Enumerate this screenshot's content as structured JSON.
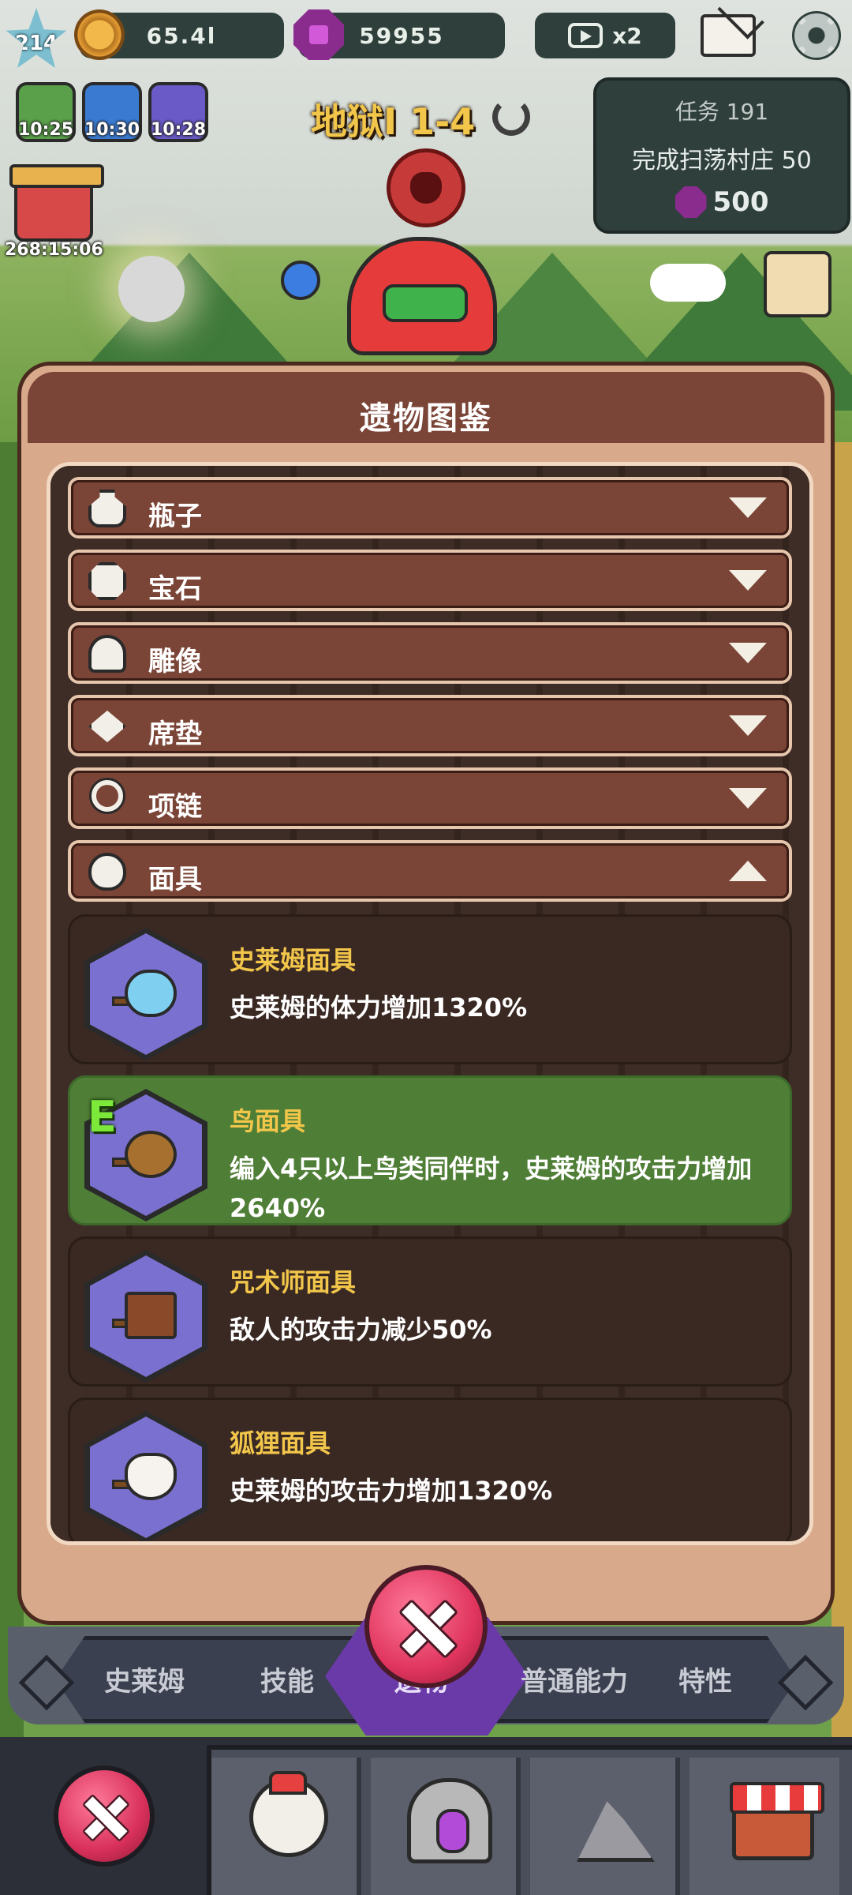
{
  "hud": {
    "level": "214",
    "gold": "65.4l",
    "gems": "59955",
    "ad_multiplier": "x2"
  },
  "boosts": {
    "timers": [
      "10:25",
      "10:30",
      "10:28"
    ],
    "chest_timer": "268:15:06"
  },
  "stage": {
    "title": "地狱I 1-4"
  },
  "quest": {
    "title": "任务 191",
    "description": "完成扫荡村庄 50",
    "reward": "500"
  },
  "modal": {
    "title": "遗物图鉴",
    "categories": [
      {
        "label": "瓶子",
        "icon": "bottle-icon",
        "expanded": false
      },
      {
        "label": "宝石",
        "icon": "gem-icon",
        "expanded": false
      },
      {
        "label": "雕像",
        "icon": "statue-icon",
        "expanded": false
      },
      {
        "label": "席垫",
        "icon": "mat-icon",
        "expanded": false
      },
      {
        "label": "项链",
        "icon": "necklace-icon",
        "expanded": false
      },
      {
        "label": "面具",
        "icon": "mask-icon",
        "expanded": true
      }
    ],
    "relics": [
      {
        "name": "史莱姆面具",
        "desc": "史莱姆的体力增加1320%",
        "equipped": false
      },
      {
        "name": "鸟面具",
        "desc": "编入4只以上鸟类同伴时，史莱姆的攻击力增加2640%",
        "equipped": true,
        "badge": "E"
      },
      {
        "name": "咒术师面具",
        "desc": "敌人的攻击力减少50%",
        "equipped": false
      },
      {
        "name": "狐狸面具",
        "desc": "史莱姆的攻击力增加1320%",
        "equipped": false
      }
    ]
  },
  "tabs": {
    "items": [
      "史莱姆",
      "技能",
      "遗物",
      "普通能力",
      "特性"
    ]
  },
  "colors": {
    "accent_gold": "#f2c64a",
    "equipped_green": "#4f7e36",
    "modal_brown": "#7a4436",
    "close_pink": "#e0355e"
  }
}
